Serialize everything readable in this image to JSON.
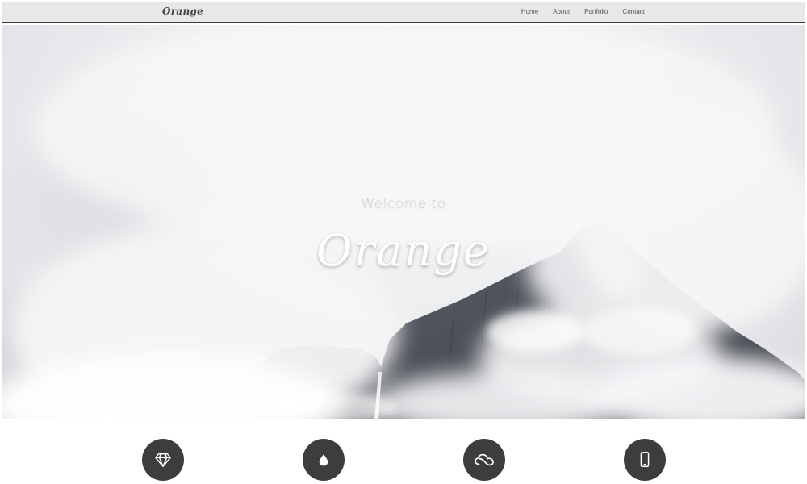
{
  "brand": {
    "name": "Orange"
  },
  "nav": {
    "items": [
      {
        "label": "Home"
      },
      {
        "label": "About"
      },
      {
        "label": "Portfolio"
      },
      {
        "label": "Contact"
      }
    ]
  },
  "hero": {
    "welcome_text": "Welcome to",
    "title": "Orange"
  },
  "features": {
    "icons": [
      "diamond-icon",
      "drop-icon",
      "cloud-icon",
      "mobile-icon"
    ]
  },
  "colors": {
    "navbar_bg": "#e8e8e8",
    "icon_circle": "#3d3d3d",
    "hero_fog": "#eeeff1"
  }
}
